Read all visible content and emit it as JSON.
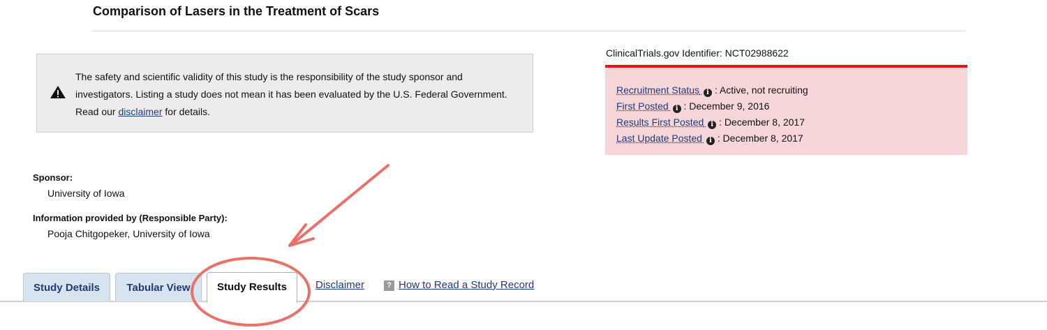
{
  "page": {
    "title": "Comparison of Lasers in the Treatment of Scars"
  },
  "disclaimer_box": {
    "text_before": "The safety and scientific validity of this study is the responsibility of the study sponsor and investigators. Listing a study does not mean it has been evaluated by the U.S. Federal Government. Read our ",
    "link_text": "disclaimer",
    "text_after": " for details.",
    "icon": "warning-icon"
  },
  "identifier": {
    "text": "ClinicalTrials.gov Identifier: NCT02988622"
  },
  "status": {
    "accent_color": "#e8141c",
    "background_color": "#f6d6d8",
    "rows": [
      {
        "label": "Recruitment Status",
        "value": " : Active, not recruiting"
      },
      {
        "label": "First Posted",
        "value": " : December 9, 2016"
      },
      {
        "label": "Results First Posted",
        "value": " : December 8, 2017"
      },
      {
        "label": "Last Update Posted",
        "value": " : December 8, 2017"
      }
    ],
    "info_icon": "info-icon"
  },
  "sponsor": {
    "label": "Sponsor:",
    "value": "University of Iowa"
  },
  "responsible_party": {
    "label": "Information provided by (Responsible Party):",
    "value": "Pooja Chitgopeker, University of Iowa"
  },
  "tabs": [
    {
      "label": "Study Details",
      "active": false
    },
    {
      "label": "Tabular View",
      "active": false
    },
    {
      "label": "Study Results",
      "active": true
    }
  ],
  "links": {
    "disclaimer": "Disclaimer",
    "how_to_read": "How to Read a Study Record",
    "help_icon_glyph": "?"
  },
  "annotation": {
    "color": "#e8726a",
    "shapes": [
      "arrow",
      "circle"
    ]
  }
}
